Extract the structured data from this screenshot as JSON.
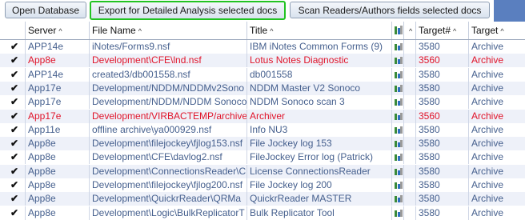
{
  "toolbar": {
    "open_db": "Open Database",
    "export": "Export for Detailed Analysis selected docs",
    "scan": "Scan Readers/Authors fields selected docs"
  },
  "headers": {
    "server": "Server",
    "filename": "File Name",
    "title": "Title",
    "target_num": "Target#",
    "target": "Target"
  },
  "colors": {
    "normal_text": "#46608e",
    "alert_text": "#e0142a",
    "highlight_border": "#22c322",
    "alt_row": "#eef1f9"
  },
  "rows": [
    {
      "server": "APP14e",
      "file": "iNotes/Forms9.nsf",
      "title": "IBM iNotes Common Forms (9)",
      "num": "3580",
      "target": "Archive",
      "red": false
    },
    {
      "server": "App8e",
      "file": "Development\\CFE\\lnd.nsf",
      "title": "Lotus Notes Diagnostic",
      "num": "3560",
      "target": "Archive",
      "red": true
    },
    {
      "server": "APP14e",
      "file": "created3/db001558.nsf",
      "title": "db001558",
      "num": "3580",
      "target": "Archive",
      "red": false
    },
    {
      "server": "App17e",
      "file": "Development/NDDM/NDDMv2Sono",
      "title": "NDDM Master V2 Sonoco",
      "num": "3580",
      "target": "Archive",
      "red": false
    },
    {
      "server": "App17e",
      "file": "Development/NDDM/NDDM Sonoco",
      "title": "NDDM Sonoco scan 3",
      "num": "3580",
      "target": "Archive",
      "red": false
    },
    {
      "server": "App17e",
      "file": "Development/VIRBACTEMP/archive",
      "title": "Archiver",
      "num": "3560",
      "target": "Archive",
      "red": true
    },
    {
      "server": "App11e",
      "file": "offline archive\\ya000929.nsf",
      "title": "Info NU3",
      "num": "3580",
      "target": "Archive",
      "red": false
    },
    {
      "server": "App8e",
      "file": "Development\\filejockey\\fjlog153.nsf",
      "title": "File Jockey log 153",
      "num": "3580",
      "target": "Archive",
      "red": false
    },
    {
      "server": "App8e",
      "file": "Development\\CFE\\davlog2.nsf",
      "title": "FileJockey Error log (Patrick)",
      "num": "3580",
      "target": "Archive",
      "red": false
    },
    {
      "server": "App8e",
      "file": "Development\\ConnectionsReader\\C",
      "title": "License ConnectionsReader",
      "num": "3580",
      "target": "Archive",
      "red": false
    },
    {
      "server": "App8e",
      "file": "Development\\filejockey\\fjlog200.nsf",
      "title": "File Jockey log 200",
      "num": "3580",
      "target": "Archive",
      "red": false
    },
    {
      "server": "App8e",
      "file": "Development\\QuickrReader\\QRMa",
      "title": "QuickrReader MASTER",
      "num": "3580",
      "target": "Archive",
      "red": false
    },
    {
      "server": "App8e",
      "file": "Development\\Logic\\BulkReplicatorT",
      "title": "Bulk Replicator Tool",
      "num": "3580",
      "target": "Archive",
      "red": false
    }
  ]
}
